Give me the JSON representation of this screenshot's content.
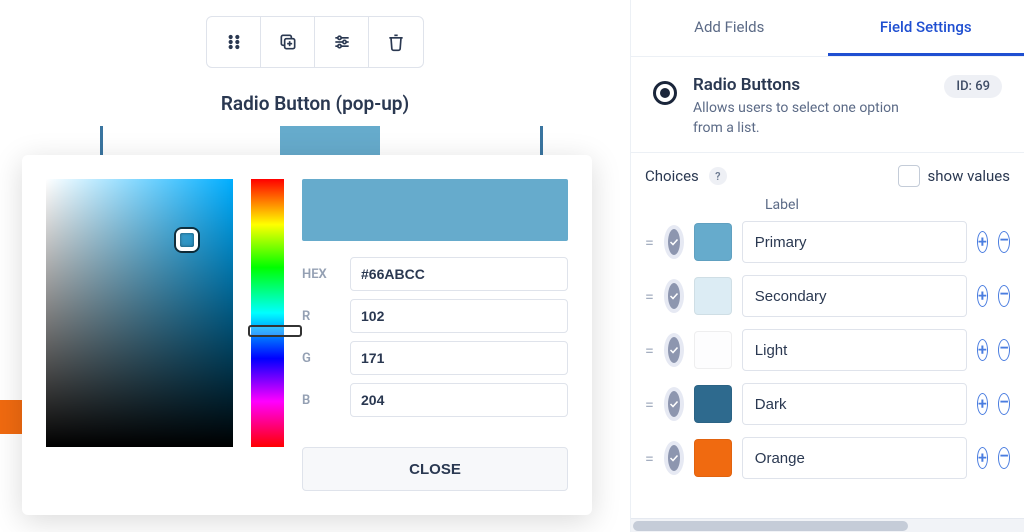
{
  "field_title": "Radio Button (pop-up)",
  "color_picker": {
    "labels": {
      "hex": "HEX",
      "r": "R",
      "g": "G",
      "b": "B"
    },
    "hex": "#66ABCC",
    "r": "102",
    "g": "171",
    "b": "204",
    "close_label": "CLOSE",
    "swatch_color": "#66abcc"
  },
  "right_panel": {
    "tabs": {
      "add_fields": "Add Fields",
      "field_settings": "Field Settings"
    },
    "field": {
      "title": "Radio Buttons",
      "description": "Allows users to select one option from a list.",
      "id_badge": "ID: 69"
    },
    "choices": {
      "label": "Choices",
      "help": "?",
      "show_values": "show values",
      "column_label": "Label",
      "items": [
        {
          "color": "#66abcc",
          "label": "Primary"
        },
        {
          "color": "#dcecf4",
          "label": "Secondary"
        },
        {
          "color": "#fdfdfe",
          "label": "Light"
        },
        {
          "color": "#2e6a8e",
          "label": "Dark"
        },
        {
          "color": "#f06a10",
          "label": "Orange"
        }
      ]
    }
  }
}
